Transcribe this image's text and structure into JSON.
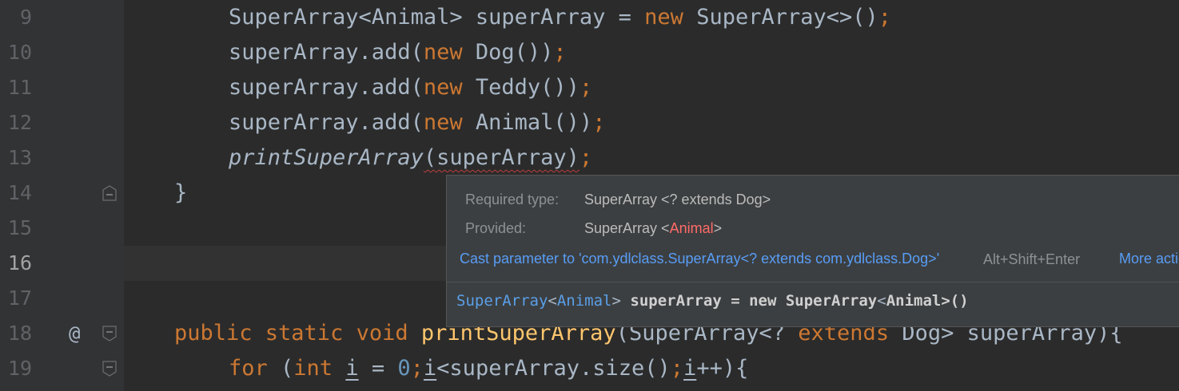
{
  "editor": {
    "lines": [
      {
        "num": "9",
        "tokens": [
          {
            "t": "SuperArray<Animal> superArray = ",
            "c": ""
          },
          {
            "t": "new",
            "c": "kw"
          },
          {
            "t": " SuperArray<>()",
            "c": ""
          },
          {
            "t": ";",
            "c": "kw"
          }
        ]
      },
      {
        "num": "10",
        "tokens": [
          {
            "t": "superArray.add(",
            "c": ""
          },
          {
            "t": "new",
            "c": "kw"
          },
          {
            "t": " Dog())",
            "c": ""
          },
          {
            "t": ";",
            "c": "kw"
          }
        ]
      },
      {
        "num": "11",
        "tokens": [
          {
            "t": "superArray.add(",
            "c": ""
          },
          {
            "t": "new",
            "c": "kw"
          },
          {
            "t": " Teddy())",
            "c": ""
          },
          {
            "t": ";",
            "c": "kw"
          }
        ]
      },
      {
        "num": "12",
        "tokens": [
          {
            "t": "superArray.add(",
            "c": ""
          },
          {
            "t": "new",
            "c": "kw"
          },
          {
            "t": " Animal())",
            "c": ""
          },
          {
            "t": ";",
            "c": "kw"
          }
        ]
      },
      {
        "num": "13",
        "tokens": [
          {
            "t": "printSuperArray",
            "c": "ital"
          },
          {
            "t": "(superArray)",
            "c": "err"
          },
          {
            "t": ";",
            "c": "kw"
          }
        ]
      },
      {
        "num": "14",
        "tokens": [
          {
            "t": "}",
            "c": ""
          }
        ]
      },
      {
        "num": "15",
        "tokens": []
      },
      {
        "num": "16",
        "tokens": []
      },
      {
        "num": "17",
        "tokens": []
      },
      {
        "num": "18",
        "tokens": [
          {
            "t": "public static void ",
            "c": "kw"
          },
          {
            "t": "printSuperArray",
            "c": "method"
          },
          {
            "t": "(SuperArray<? ",
            "c": ""
          },
          {
            "t": "extends",
            "c": "kw"
          },
          {
            "t": " Dog> superArray){",
            "c": ""
          }
        ]
      },
      {
        "num": "19",
        "tokens": [
          {
            "t": "for ",
            "c": "kw"
          },
          {
            "t": "(",
            "c": ""
          },
          {
            "t": "int ",
            "c": "kw"
          },
          {
            "t": "i",
            "c": "ul"
          },
          {
            "t": " = ",
            "c": ""
          },
          {
            "t": "0",
            "c": "num"
          },
          {
            "t": ";",
            "c": "kw"
          },
          {
            "t": "i",
            "c": "ul"
          },
          {
            "t": "<superArray.size()",
            "c": ""
          },
          {
            "t": ";",
            "c": "kw"
          },
          {
            "t": "i",
            "c": "ul"
          },
          {
            "t": "++){",
            "c": ""
          }
        ]
      }
    ],
    "gutter_marker": "@"
  },
  "popup": {
    "required_label": "Required type:",
    "required_value": "SuperArray <? extends Dog>",
    "provided_label": "Provided:",
    "provided_prefix": "SuperArray <",
    "provided_type": "Animal",
    "provided_suffix": ">",
    "fix_action": "Cast parameter to 'com.ydlclass.SuperArray<? extends com.ydlclass.Dog>'",
    "fix_shortcut": "Alt+Shift+Enter",
    "more_actions": "More actions...",
    "decl_type": "SuperArray",
    "decl_lt": "<",
    "decl_generic": "Animal",
    "decl_gt": ">",
    "decl_var": " superArray",
    "decl_mid": " = new ",
    "decl_type2": "SuperArray",
    "decl_generic2": "Animal",
    "decl_end": ">()"
  },
  "colors": {
    "keyword": "#cc7832",
    "method": "#ffc66d",
    "number": "#6897bb",
    "text": "#a9b7c6",
    "error": "#bc3f3c",
    "link": "#589df6"
  }
}
